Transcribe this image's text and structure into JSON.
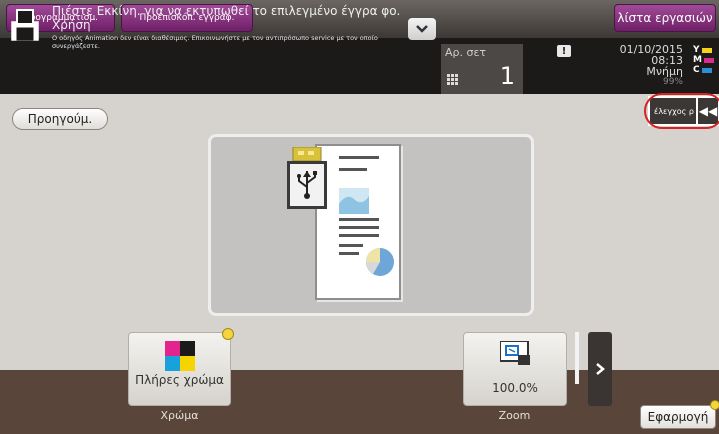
{
  "topbar": {
    "program_label": "Προγραμματισμ.",
    "preview_label": "Προεπισκόπ. εγγράφ.",
    "job_list_label": "λίστα εργασιών"
  },
  "message": {
    "main_text": "Πιέστε Εκκίνη. για να εκτυπωθεί το επιλεγμένο έγγρα φο. Χρήση",
    "sub_text": "Ο οδηγός Animation δεν είναι διαθέσιμος. Επικοινωνήστε με τον αντιπρόσωπο service με τον οποίο συνεργάζεστε."
  },
  "sets": {
    "label": "Αρ. σετ",
    "value": "1"
  },
  "status": {
    "date": "01/10/2015",
    "time": "08:13",
    "memory_label": "Μνήμη",
    "memory_value": "99%",
    "toner": [
      {
        "letter": "Y",
        "color": "#f4d21e"
      },
      {
        "letter": "M",
        "color": "#d92b8c"
      },
      {
        "letter": "C",
        "color": "#2c8fd6"
      }
    ]
  },
  "nav": {
    "back_label": "Προηγούμ.",
    "toggle_label": "έλεγχος ρ",
    "collapse_symbol": "◀◀"
  },
  "functions": {
    "color": {
      "value": "Πλήρες χρώμα",
      "caption": "Χρώμα"
    },
    "zoom": {
      "value": "100.0%",
      "caption": "Zoom"
    }
  },
  "footer": {
    "apply_label": "Εφαρμογή"
  },
  "colors": {
    "accent_purple": "#8e3a86",
    "highlight_red": "#d42226",
    "bottom_brown": "#59453a"
  }
}
